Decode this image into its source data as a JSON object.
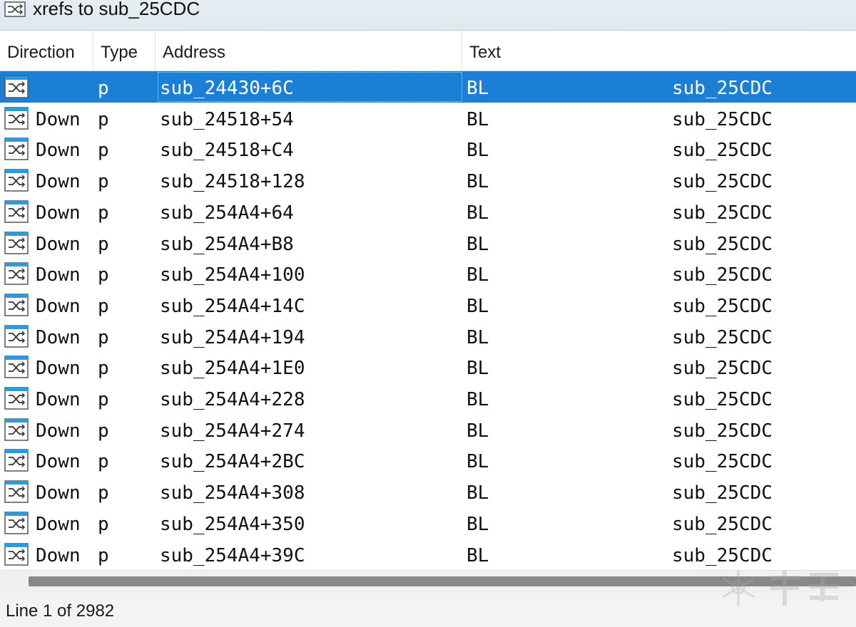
{
  "window": {
    "title": "xrefs to sub_25CDC",
    "icon": "xref-icon"
  },
  "columns": {
    "direction": "Direction",
    "type": "Type",
    "address": "Address",
    "text": "Text"
  },
  "rows": [
    {
      "direction": "",
      "type": "p",
      "address": "sub_24430+6C",
      "instr": "BL",
      "target": "sub_25CDC",
      "selected": true
    },
    {
      "direction": "Down",
      "type": "p",
      "address": "sub_24518+54",
      "instr": "BL",
      "target": "sub_25CDC"
    },
    {
      "direction": "Down",
      "type": "p",
      "address": "sub_24518+C4",
      "instr": "BL",
      "target": "sub_25CDC"
    },
    {
      "direction": "Down",
      "type": "p",
      "address": "sub_24518+128",
      "instr": "BL",
      "target": "sub_25CDC"
    },
    {
      "direction": "Down",
      "type": "p",
      "address": "sub_254A4+64",
      "instr": "BL",
      "target": "sub_25CDC"
    },
    {
      "direction": "Down",
      "type": "p",
      "address": "sub_254A4+B8",
      "instr": "BL",
      "target": "sub_25CDC"
    },
    {
      "direction": "Down",
      "type": "p",
      "address": "sub_254A4+100",
      "instr": "BL",
      "target": "sub_25CDC"
    },
    {
      "direction": "Down",
      "type": "p",
      "address": "sub_254A4+14C",
      "instr": "BL",
      "target": "sub_25CDC"
    },
    {
      "direction": "Down",
      "type": "p",
      "address": "sub_254A4+194",
      "instr": "BL",
      "target": "sub_25CDC"
    },
    {
      "direction": "Down",
      "type": "p",
      "address": "sub_254A4+1E0",
      "instr": "BL",
      "target": "sub_25CDC"
    },
    {
      "direction": "Down",
      "type": "p",
      "address": "sub_254A4+228",
      "instr": "BL",
      "target": "sub_25CDC"
    },
    {
      "direction": "Down",
      "type": "p",
      "address": "sub_254A4+274",
      "instr": "BL",
      "target": "sub_25CDC"
    },
    {
      "direction": "Down",
      "type": "p",
      "address": "sub_254A4+2BC",
      "instr": "BL",
      "target": "sub_25CDC"
    },
    {
      "direction": "Down",
      "type": "p",
      "address": "sub_254A4+308",
      "instr": "BL",
      "target": "sub_25CDC"
    },
    {
      "direction": "Down",
      "type": "p",
      "address": "sub_254A4+350",
      "instr": "BL",
      "target": "sub_25CDC"
    },
    {
      "direction": "Down",
      "type": "p",
      "address": "sub_254A4+39C",
      "instr": "BL",
      "target": "sub_25CDC"
    }
  ],
  "status": {
    "text": "Line 1 of 2982"
  },
  "colors": {
    "selection": "#1c7fd6",
    "icon_accent": "#2b9be0"
  },
  "watermark": {
    "icon": "snowflake-watermark-icon"
  }
}
